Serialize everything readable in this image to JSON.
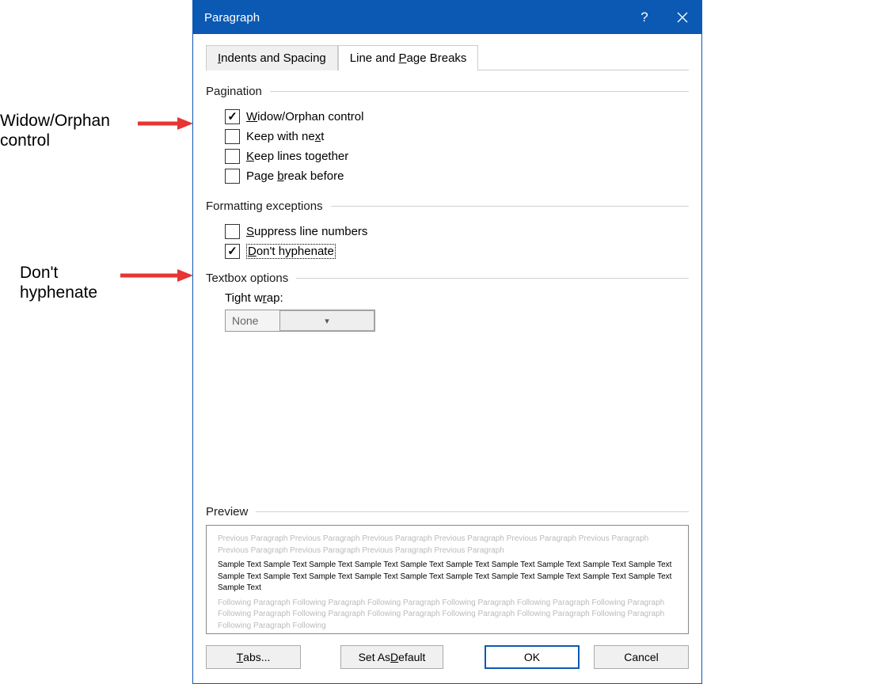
{
  "dialog": {
    "title": "Paragraph"
  },
  "tabs": {
    "indents": "Indents and Spacing",
    "breaks": "Line and Page Breaks"
  },
  "sections": {
    "pagination": "Pagination",
    "formatting": "Formatting exceptions",
    "textbox": "Textbox options",
    "preview": "Preview"
  },
  "pagination": {
    "widow": "Widow/Orphan control",
    "keep_next": "Keep with next",
    "keep_lines": "Keep lines together",
    "page_break": "Page break before",
    "widow_checked": true
  },
  "formatting": {
    "suppress": "Suppress line numbers",
    "dont_hyphenate": "Don't hyphenate",
    "dont_hyphenate_checked": true
  },
  "textbox": {
    "tight_wrap_label": "Tight wrap:",
    "tight_wrap_value": "None"
  },
  "preview": {
    "prev": "Previous Paragraph Previous Paragraph Previous Paragraph Previous Paragraph Previous Paragraph Previous Paragraph Previous Paragraph Previous Paragraph Previous Paragraph Previous Paragraph",
    "sample": "Sample Text Sample Text Sample Text Sample Text Sample Text Sample Text Sample Text Sample Text Sample Text Sample Text Sample Text Sample Text Sample Text Sample Text Sample Text Sample Text Sample Text Sample Text Sample Text Sample Text Sample Text",
    "next": "Following Paragraph Following Paragraph Following Paragraph Following Paragraph Following Paragraph Following Paragraph Following Paragraph Following Paragraph Following Paragraph Following Paragraph Following Paragraph Following Paragraph Following Paragraph Following"
  },
  "buttons": {
    "tabs": "Tabs...",
    "default": "Set As Default",
    "ok": "OK",
    "cancel": "Cancel"
  },
  "annotations": {
    "widow": "Widow/Orphan\ncontrol",
    "hyphen": "Don't\nhyphenate"
  }
}
